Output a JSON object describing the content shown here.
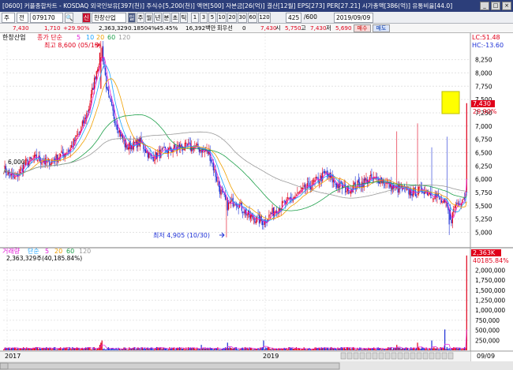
{
  "window": {
    "title": "[0600] 커플종합차트 - KOSDAQ 외국인보유[397(천)] 주식수[5,200(천)] 액면[500] 자본금[26(억)] 결산[12월] EPS[273] PER[27.21] 시가총액[386(억)] 유통비율[44.0]",
    "controls": [
      "_",
      "□",
      "×"
    ]
  },
  "toolbar": {
    "market": "주",
    "search": "전",
    "code": "079170",
    "search_glyph": "🔍",
    "market_glyph": "신",
    "name": "한창산업",
    "period_buttons": [
      "일",
      "주",
      "월",
      "년",
      "분",
      "초",
      "틱"
    ],
    "selected_period": "일",
    "interval_buttons": [
      "1",
      "3",
      "5",
      "10",
      "20",
      "30",
      "60",
      "120"
    ],
    "count": "425",
    "count_total": "/600",
    "date": "2019/09/09"
  },
  "quote": {
    "price": "7,430",
    "change": "1,710",
    "change_rate": "+29.90%",
    "volume": "2,363,329",
    "turnover": "0.18504%",
    "volume_ratio": "45.45%",
    "amount": "16,392백만",
    "amount_label": "회우선",
    "extra": "0",
    "price2": "7,430",
    "open_label": "시",
    "open": "5,750",
    "high_label": "고",
    "high": "7,430",
    "low_label": "저",
    "low": "5,690",
    "buy_label": "매수",
    "sell_label": "매도"
  },
  "price_panel": {
    "name": "한창산업",
    "legend_label": "종가 단순",
    "ma_periods": [
      "5",
      "10",
      "20",
      "60",
      "120"
    ],
    "lc": "LC:51.48",
    "hc": "HC:-13.60",
    "high_annotation": "최고 8,600 (05/15)",
    "low_annotation": "최저 4,905 (10/30)",
    "left_value": "6,000",
    "current_price": "7,430",
    "current_rate": "29.90%",
    "y_ticks": [
      "8,250",
      "8,000",
      "7,750",
      "7,500",
      "7,250",
      "7,000",
      "6,750",
      "6,500",
      "6,250",
      "6,000",
      "5,750",
      "5,500",
      "5,250",
      "5,000"
    ]
  },
  "volume_panel": {
    "legend_label": "거래량",
    "legend_type": "단순",
    "ma_periods": [
      "5",
      "20",
      "60",
      "120"
    ],
    "left_value": "2,363,329주(40,185.84%)",
    "current_volume": "2,363K",
    "current_rate": "40185.84%",
    "y_ticks": [
      "2,000,000",
      "1,750,000",
      "1,500,000",
      "1,250,000",
      "1,000,000",
      "750,000",
      "500,000",
      "250,000"
    ]
  },
  "x_axis": {
    "labels": [
      "2017",
      "2019"
    ],
    "right_label": "09/09"
  },
  "colors": {
    "up": "#e0001a",
    "down": "#1c2fd6",
    "ma5": "#e31bd9",
    "ma10": "#1aa3ff",
    "ma20": "#f0a000",
    "ma60": "#1ea04a",
    "ma120": "#9a9a9a",
    "title_bg": "#2c3e7a",
    "marker": "#ffff00"
  },
  "chart_data": {
    "type": "candlestick",
    "x": [
      "2017",
      "2019",
      "09/09"
    ],
    "price_range": [
      4800,
      8600
    ],
    "volume_range": [
      0,
      2400000
    ],
    "highest": {
      "value": 8600,
      "date": "05/15"
    },
    "lowest": {
      "value": 4905,
      "date": "10/30"
    },
    "last": {
      "close": 7430,
      "open": 5750,
      "high": 7430,
      "low": 5690,
      "volume": 2363329
    },
    "anchors": [
      [
        0,
        6200
      ],
      [
        10,
        6000
      ],
      [
        20,
        6300
      ],
      [
        30,
        6400
      ],
      [
        40,
        6300
      ],
      [
        60,
        6550
      ],
      [
        70,
        6900
      ],
      [
        78,
        7350
      ],
      [
        85,
        8050
      ],
      [
        90,
        8450
      ],
      [
        95,
        7600
      ],
      [
        102,
        7100
      ],
      [
        112,
        6600
      ],
      [
        125,
        6700
      ],
      [
        135,
        6400
      ],
      [
        145,
        6500
      ],
      [
        160,
        6600
      ],
      [
        175,
        6600
      ],
      [
        188,
        6500
      ],
      [
        198,
        5800
      ],
      [
        205,
        5500
      ],
      [
        212,
        5600
      ],
      [
        225,
        5300
      ],
      [
        238,
        5200
      ],
      [
        250,
        5450
      ],
      [
        262,
        5600
      ],
      [
        275,
        5800
      ],
      [
        285,
        5950
      ],
      [
        295,
        6100
      ],
      [
        305,
        5900
      ],
      [
        315,
        5800
      ],
      [
        325,
        5900
      ],
      [
        335,
        6000
      ],
      [
        345,
        6000
      ],
      [
        355,
        5850
      ],
      [
        365,
        5800
      ],
      [
        375,
        5750
      ],
      [
        385,
        5800
      ],
      [
        395,
        5700
      ],
      [
        405,
        5500
      ],
      [
        410,
        5250
      ],
      [
        413,
        5500
      ],
      [
        418,
        5600
      ],
      [
        423,
        5700
      ]
    ]
  }
}
